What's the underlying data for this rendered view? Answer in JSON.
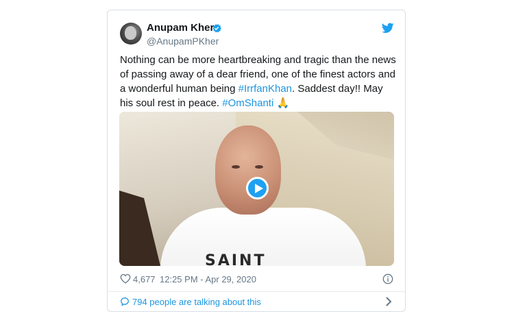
{
  "tweet": {
    "author_name": "Anupam Kher",
    "handle": "@AnupamPKher",
    "text_part1": "Nothing can be more heartbreaking and tragic than the news of passing away of a dear friend, one of the finest actors and a wonderful human being ",
    "hashtag1": "#IrrfanKhan",
    "text_part2": ". Saddest day!! May his soul rest in peace. ",
    "hashtag2": "#OmShanti",
    "emoji": "🙏",
    "shirt_print": "SAINT",
    "likes": "4,677",
    "timestamp": "12:25 PM - Apr 29, 2020",
    "talking": "794 people are talking about this"
  },
  "icons": {
    "verified": "verified-badge-icon",
    "brand": "twitter-bird-icon",
    "like": "heart-icon",
    "info": "info-icon",
    "reply": "comment-icon",
    "more": "chevron-right-icon"
  },
  "colors": {
    "twitter_blue": "#1da1f2",
    "link": "#1b95e0",
    "text": "#14171a",
    "muted": "#657786"
  }
}
